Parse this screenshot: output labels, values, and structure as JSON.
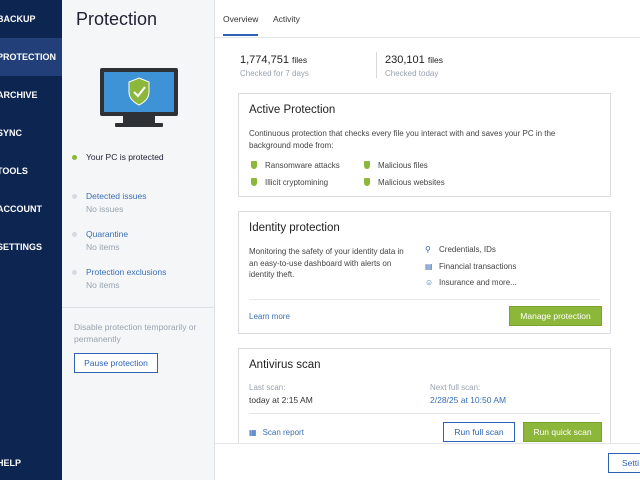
{
  "nav": {
    "items": [
      {
        "label": "BACKUP"
      },
      {
        "label": "PROTECTION"
      },
      {
        "label": "ARCHIVE"
      },
      {
        "label": "SYNC"
      },
      {
        "label": "TOOLS"
      },
      {
        "label": "ACCOUNT"
      },
      {
        "label": "SETTINGS"
      }
    ],
    "help_label": "HELP",
    "active_color": "#233f7a",
    "background_color": "#0d2551"
  },
  "status_panel": {
    "title": "Protection",
    "pc_status": "Your PC is protected",
    "pc_status_color": "#8db73a",
    "rows": [
      {
        "label": "Detected issues",
        "value": "No issues"
      },
      {
        "label": "Quarantine",
        "value": "No items"
      },
      {
        "label": "Protection exclusions",
        "value": "No items"
      }
    ],
    "disable_text": "Disable protection temporarily or permanently",
    "pause_button": "Pause protection",
    "monitor_icon": "shield-check-icon"
  },
  "tabs": [
    {
      "label": "Overview",
      "active": true
    },
    {
      "label": "Activity",
      "active": false
    }
  ],
  "stats": [
    {
      "value": "1,774,751",
      "unit": "files",
      "caption": "Checked for 7 days"
    },
    {
      "value": "230,101",
      "unit": "files",
      "caption": "Checked today"
    }
  ],
  "active_protection": {
    "title": "Active Protection",
    "description": "Continuous protection that checks every file you interact with and saves your PC in the background mode from:",
    "items": [
      "Ransomware attacks",
      "Malicious files",
      "Illicit cryptomining",
      "Malicious websites"
    ]
  },
  "identity_protection": {
    "title": "Identity protection",
    "description": "Monitoring the safety of your identity data in an easy-to-use dashboard with alerts on identity theft.",
    "features": [
      {
        "label": "Credentials, IDs",
        "icon": "key-icon"
      },
      {
        "label": "Financial transactions",
        "icon": "bank-icon"
      },
      {
        "label": "Insurance and more...",
        "icon": "people-icon"
      }
    ],
    "learn_more": "Learn more",
    "manage_button": "Manage protection"
  },
  "antivirus": {
    "title": "Antivirus scan",
    "last_scan_label": "Last scan:",
    "last_scan_value": "today at 2:15 AM",
    "next_scan_label": "Next full scan:",
    "next_scan_value": "2/28/25 at 10:50 AM",
    "scan_report": "Scan report",
    "full_scan_button": "Run full scan",
    "quick_scan_button": "Run quick scan"
  },
  "bottom_bar": {
    "settings_button": "Setti"
  },
  "colors": {
    "accent": "#2d62b6",
    "green": "#8db73a"
  }
}
